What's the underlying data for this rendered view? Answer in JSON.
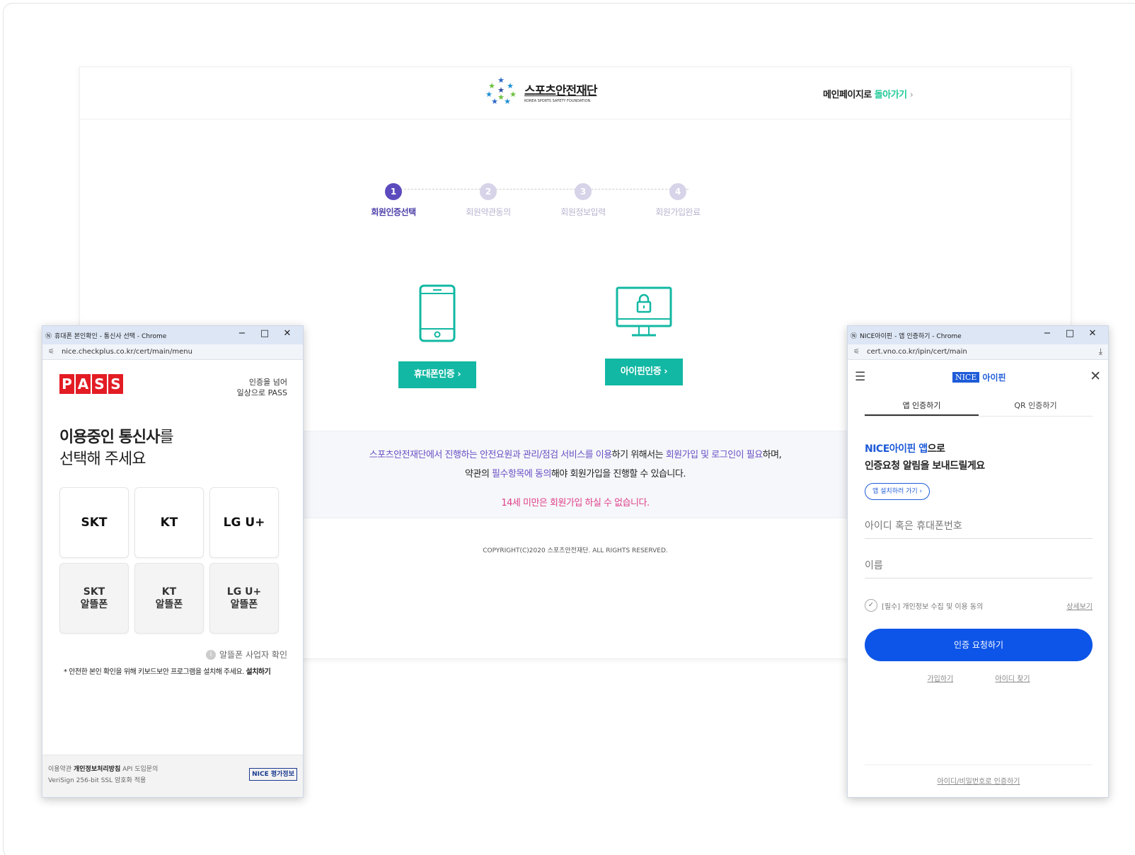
{
  "site": {
    "logo_ko": "스포츠안전재단",
    "logo_en": "KOREA SPORTS SAFETY FOUNDATION",
    "back_prefix": "메인페이지로",
    "back_green": "돌아가기",
    "back_chevron": "›",
    "steps": [
      {
        "num": "1",
        "label": "회원인증선택"
      },
      {
        "num": "2",
        "label": "회원약관동의"
      },
      {
        "num": "3",
        "label": "회원정보입력"
      },
      {
        "num": "4",
        "label": "회원가입완료"
      }
    ],
    "phone_btn": "휴대폰인증 ›",
    "ipin_btn": "아이핀인증 ›",
    "notice_1a": "스포츠안전재단에서 진행하는 안전요원과 관리/점검 서비스를 이용",
    "notice_1b": "하기 위해서는 ",
    "notice_1c": "회원가입 및 로그인이 필요",
    "notice_1d": "하며,",
    "notice_2a": "약관의 ",
    "notice_2b": "필수항목에 동의",
    "notice_2c": "해야 회원가입을 진행할 수 있습니다.",
    "notice_3": "14세 미만은 회원가입 하실 수 없습니다.",
    "copyright": "COPYRIGHT(C)2020 스포츠안전재단. ALL RIGHTS RESERVED."
  },
  "pass": {
    "window_title": "휴대폰 본인확인 - 통신사 선택 - Chrome",
    "url": "nice.checkplus.co.kr/cert/main/menu",
    "logo_letters": [
      "P",
      "A",
      "S",
      "S"
    ],
    "tagline_1": "인증을 넘어",
    "tagline_2": "일상으로 PASS",
    "heading_bold": "이용중인 통신사",
    "heading_rest": "를",
    "heading_2": "선택해 주세요",
    "carriers": [
      "SKT",
      "KT",
      "LG U+"
    ],
    "mvno": [
      "SKT\n알뜰폰",
      "KT\n알뜰폰",
      "LG U+\n알뜰폰"
    ],
    "mvno_check": "알뜰폰 사업자 확인",
    "kb_note": "* 안전한 본인 확인을 위해 키보드보안 프로그램을 설치해 주세요.",
    "kb_install": "설치하기",
    "footer_terms": "이용약관",
    "footer_privacy": "개인정보처리방침",
    "footer_api": "API 도입문의",
    "footer_ssl": "VeriSign 256-bit SSL 암호화 적용",
    "nice_badge": "NICE 평가정보"
  },
  "ipin": {
    "window_title": "NICE아이핀 - 앱 인증하기 - Chrome",
    "url": "cert.vno.co.kr/ipin/cert/main",
    "logo_box": "NICE",
    "logo_name": "아이핀",
    "tab_app": "앱 인증하기",
    "tab_qr": "QR 인증하기",
    "msg_blue": "NICE아이핀 앱",
    "msg_rest": "으로",
    "msg_2": "인증요청 알림을 보내드릴게요",
    "install_btn": "앱 설치하러 가기 ›",
    "id_placeholder": "아이디 혹은 휴대폰번호",
    "name_placeholder": "이름",
    "agree_text": "[필수] 개인정보 수집 및 이용 동의",
    "agree_more": "상세보기",
    "request_btn": "인증 요청하기",
    "signup": "가입하기",
    "find_id": "아이디 찾기",
    "bottom_link": "아이디/비밀번호로 인증하기"
  }
}
